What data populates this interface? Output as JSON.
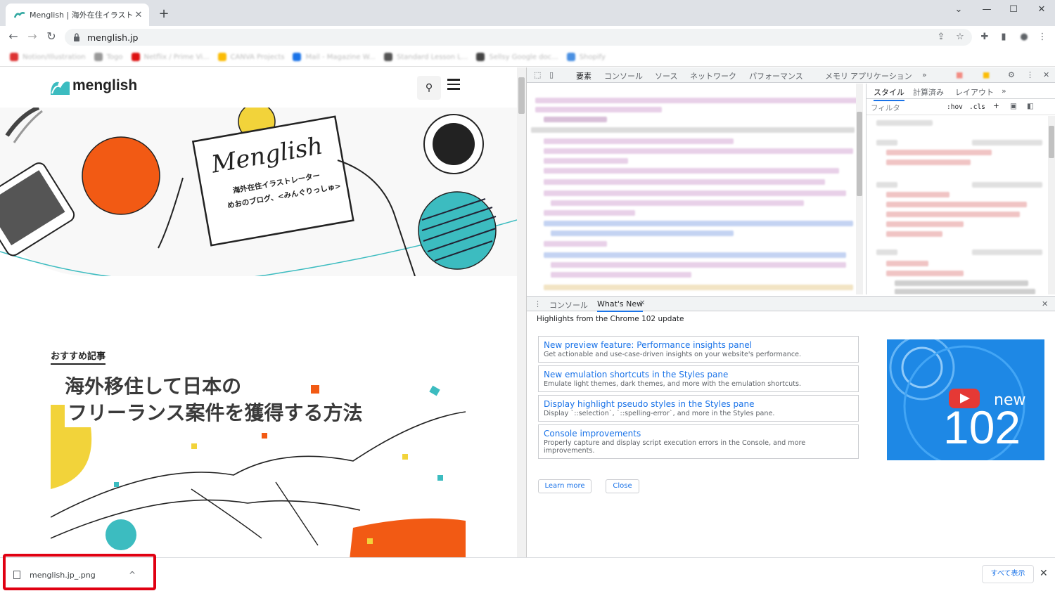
{
  "browser": {
    "tab_title": "Menglish | 海外在住イラストレー",
    "tab_close": "✕",
    "new_tab": "+",
    "url": "menglish.jp",
    "bookmarks": [
      "Notion/Illustration",
      "Togo",
      "Netflix / Prime Vi...",
      "CANVA Projects",
      "Mail - Magazine W...",
      "Standard Lesson L...",
      "Sellsy Google doc...",
      "Shopify"
    ]
  },
  "page": {
    "logo": "menglish",
    "hero_card_title": "Menglish",
    "hero_card_line1": "海外在住イラストレーター",
    "hero_card_line2": "めおのブログ、<みんぐりっしゅ>",
    "recommended_title": "おすすめ記事",
    "article_headline_1": "海外移住して日本の",
    "article_headline_2": "フリーランス案件を獲得する方法"
  },
  "devtools": {
    "tabs": [
      "要素",
      "コンソール",
      "ソース",
      "ネットワーク",
      "パフォーマンス",
      "メモリ",
      "アプリケーション"
    ],
    "more": "»",
    "styles_tabs": [
      "スタイル",
      "計算済み",
      "レイアウト"
    ],
    "filter_placeholder": "フィルタ",
    "hov": ":hov",
    "cls": ".cls",
    "drawer_tabs": [
      "コンソール",
      "What's New"
    ],
    "drawer_close": "✕",
    "highlights": "Highlights from the Chrome 102 update",
    "whats_new": [
      {
        "title": "New preview feature: Performance insights panel",
        "desc": "Get actionable and use-case-driven insights on your website's performance."
      },
      {
        "title": "New emulation shortcuts in the Styles pane",
        "desc": "Emulate light themes, dark themes, and more with the emulation shortcuts."
      },
      {
        "title": "Display highlight pseudo styles in the Styles pane",
        "desc": "Display `::selection`, `::spelling-error`, and more in the Styles pane."
      },
      {
        "title": "Console improvements",
        "desc": "Properly capture and display script execution errors in the Console, and more improvements."
      }
    ],
    "image_label_new": "new",
    "image_label_version": "102",
    "learn_more": "Learn more",
    "close": "Close"
  },
  "download": {
    "filename": "menglish.jp_.png",
    "chevron": "^",
    "show_all": "すべて表示",
    "close": "✕"
  },
  "colors": {
    "accent_red": "#e00012",
    "link_blue": "#1a73e8",
    "teal": "#3cbcc0",
    "orange": "#f25a14"
  }
}
